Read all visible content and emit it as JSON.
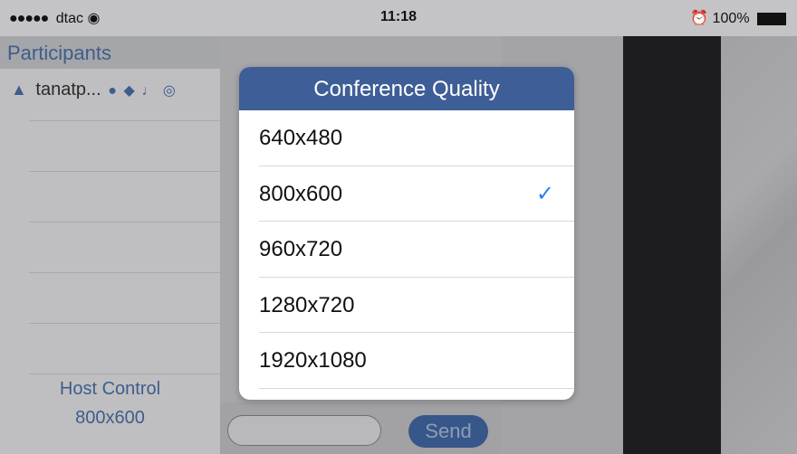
{
  "status_bar": {
    "carrier": "dtac",
    "time": "11:18",
    "battery": "100%"
  },
  "participants": {
    "title": "Participants",
    "items": [
      {
        "name": "tanatp..."
      }
    ]
  },
  "host_control": {
    "label": "Host Control",
    "resolution": "800x600"
  },
  "chat": {
    "input_placeholder": "",
    "send_label": "Send"
  },
  "modal": {
    "title": "Conference Quality",
    "options": [
      {
        "label": "640x480",
        "selected": false
      },
      {
        "label": "800x600",
        "selected": true
      },
      {
        "label": "960x720",
        "selected": false
      },
      {
        "label": "1280x720",
        "selected": false
      },
      {
        "label": "1920x1080",
        "selected": false
      }
    ]
  },
  "colors": {
    "accent": "#3e5e97",
    "check": "#2e7cf6"
  }
}
